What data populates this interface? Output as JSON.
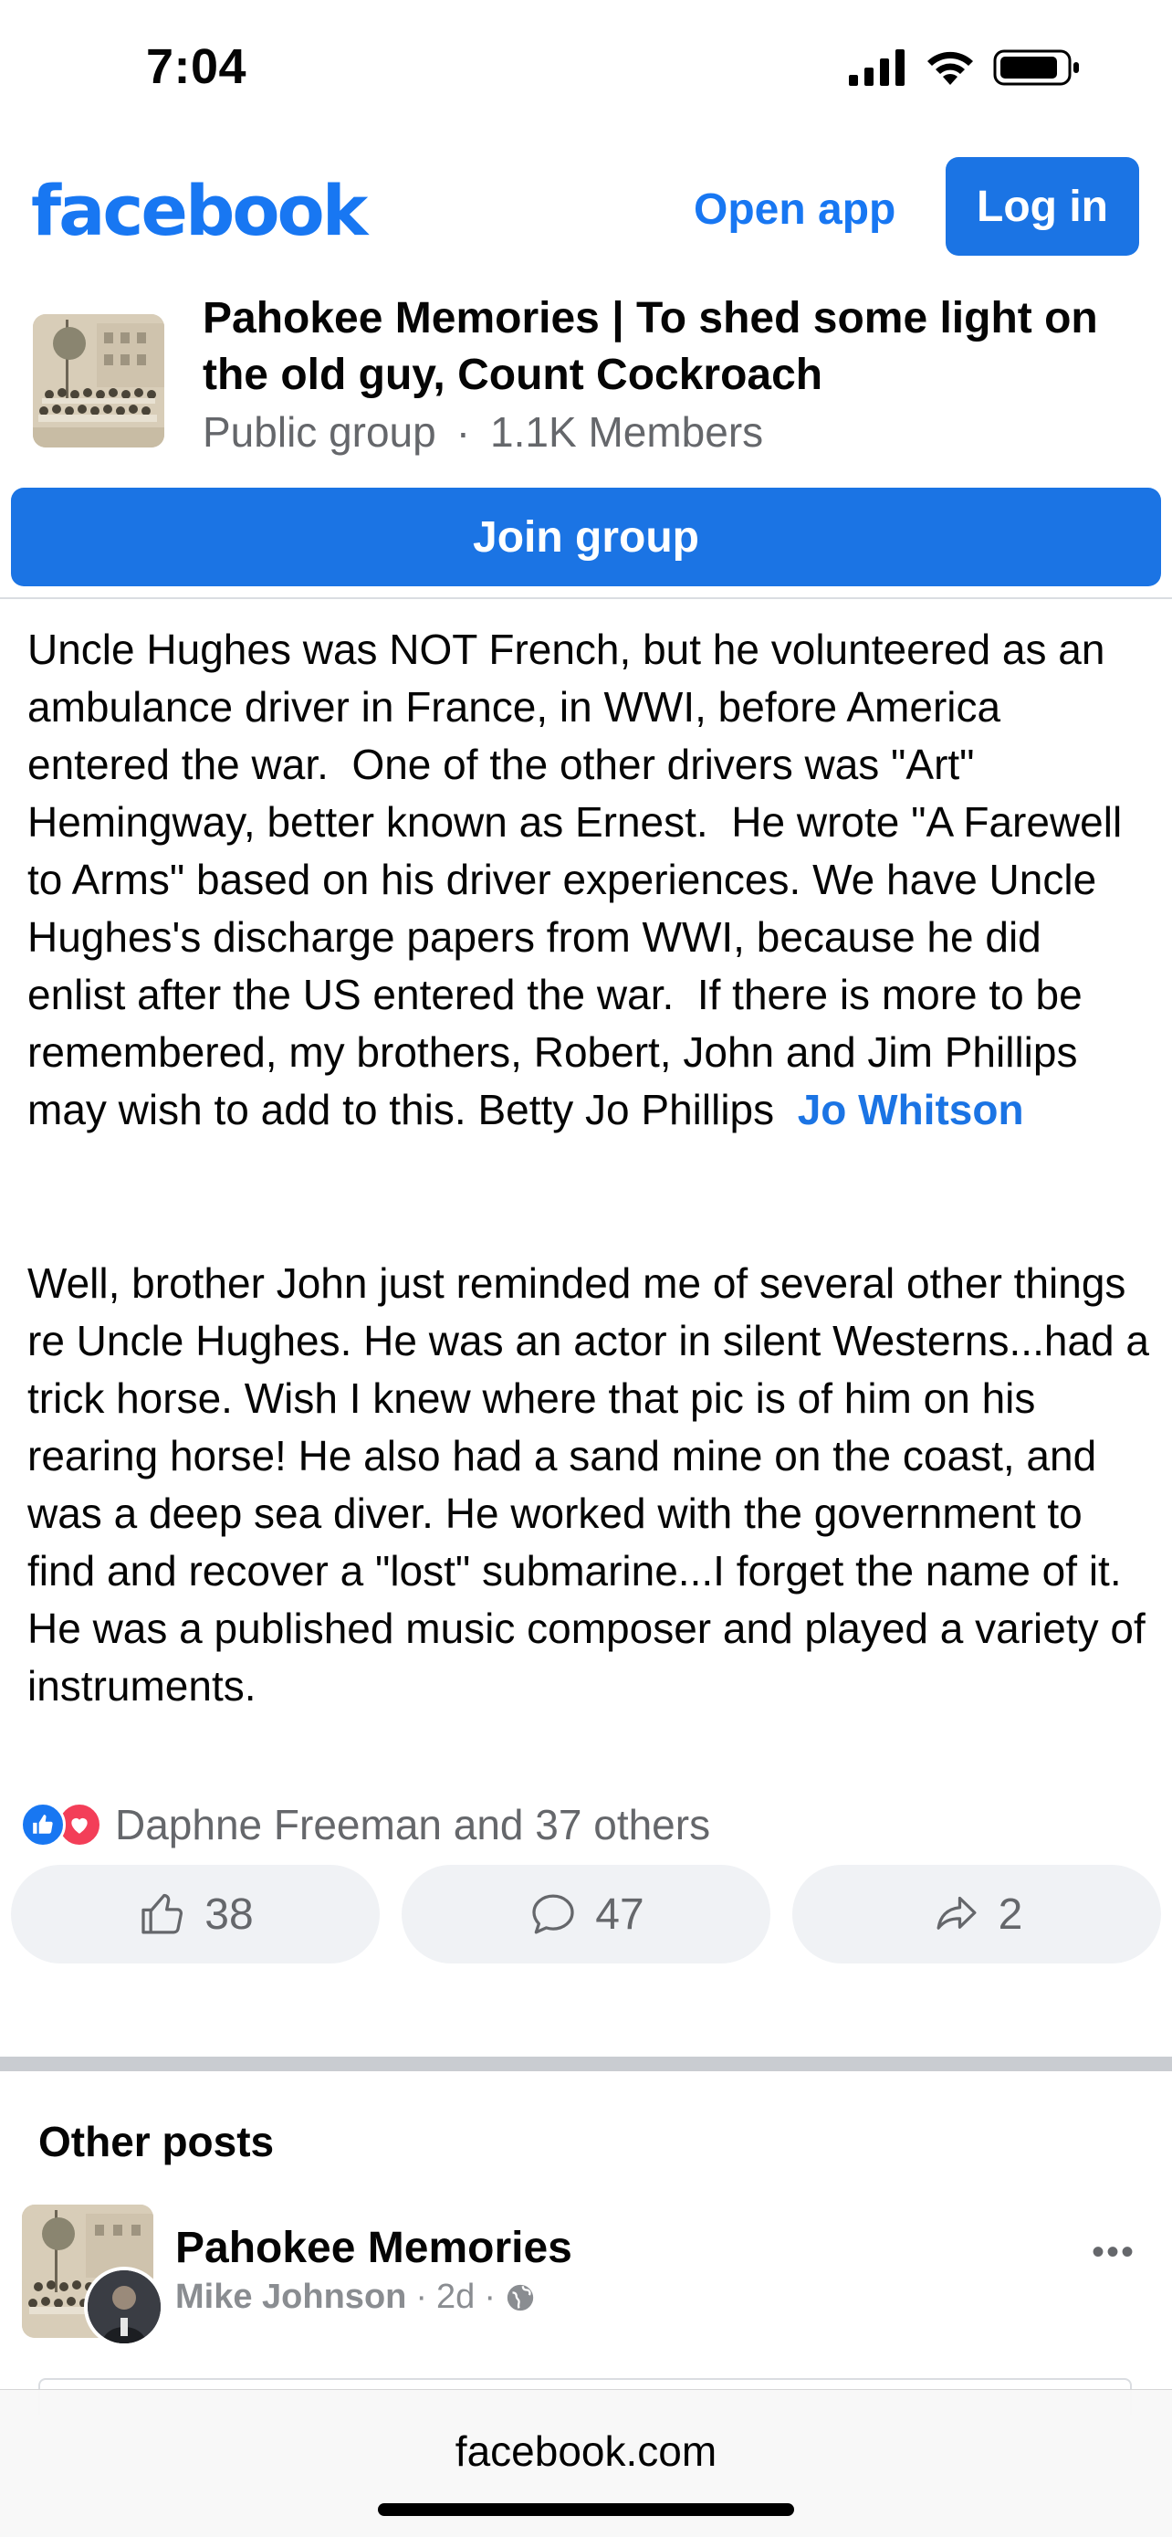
{
  "status_bar": {
    "time": "7:04"
  },
  "header": {
    "logo": "facebook",
    "open_app": "Open app",
    "login": "Log in"
  },
  "group": {
    "title": "Pahokee Memories | To shed some light on the old guy, Count Cockroach",
    "privacy": "Public group",
    "members": "1.1K Members",
    "join": "Join group"
  },
  "post": {
    "paragraph1": "Uncle Hughes was NOT French, but he volunteered as an ambulance driver in France, in WWI, before America entered the war.  One of the other drivers was \"Art\" Hemingway, better known as Ernest.  He wrote \"A Farewell to Arms\" based on his driver experiences. We have Uncle Hughes's discharge papers from WWI, because he did enlist after the US entered the war.  If there is more to be remembered, my brothers, Robert, John and Jim Phillips may wish to add to this. Betty Jo Phillips  ",
    "mention": "Jo Whitson",
    "paragraph2": "Well, brother John just reminded me of several other things re Uncle Hughes.  He was an actor in silent Westerns...had a trick horse.  Wish I knew where that pic is of him on his rearing horse! He also had a sand mine on the coast, and was a deep sea diver. He worked with the government to find and recover a \"lost\" submarine...I forget the name of it.  He was a published music composer and played a variety of instruments.",
    "reactions_text": "Daphne Freeman and 37 others",
    "like_count": "38",
    "comment_count": "47",
    "share_count": "2"
  },
  "other_posts": {
    "title": "Other posts",
    "group_name": "Pahokee Memories",
    "author": "Mike Johnson",
    "time": "2d",
    "more": "•••"
  },
  "browser": {
    "url": "facebook.com"
  },
  "colors": {
    "brand": "#1877f2",
    "button": "#1b74e4",
    "muted": "#65676b"
  }
}
